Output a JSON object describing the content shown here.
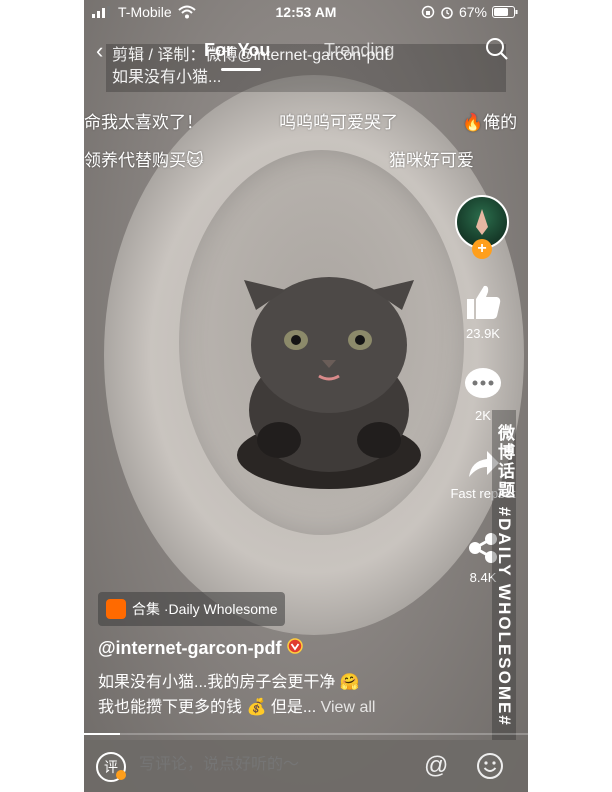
{
  "status_bar": {
    "carrier": "T-Mobile",
    "time": "12:53 AM",
    "battery": "67%"
  },
  "nav": {
    "tab_for_you": "For You",
    "tab_trending": "Trending"
  },
  "credit_overlay": {
    "line1": "剪辑 / 译制：微博@internet-garcon-pdf",
    "line2": "如果没有小猫..."
  },
  "danmaku": [
    "命我太喜欢了！",
    "呜呜呜可爱哭了",
    "俺的",
    "领养代替购买",
    "猫咪好可爱"
  ],
  "actions": {
    "likes": "23.9K",
    "comments": "2K",
    "fast_repost": "Fast repost",
    "shares": "8.4K"
  },
  "vertical_tag": "微博话题 #DAILY WHOLESOME#",
  "post": {
    "collection": "合集 ·Daily Wholesome",
    "username": "@internet-garcon-pdf",
    "caption_line1": "如果没有小猫...我的房子会更干净 🤗",
    "caption_line2": "我也能攒下更多的钱 💰 但是... ",
    "view_all": "View all"
  },
  "progress": 0.08,
  "comment_bar": {
    "badge_char": "评",
    "placeholder": "写评论，说点好听的～",
    "at_symbol": "@"
  },
  "colors": {
    "accent_orange": "#ff9f1c",
    "verified_red": "#e03b2e"
  }
}
